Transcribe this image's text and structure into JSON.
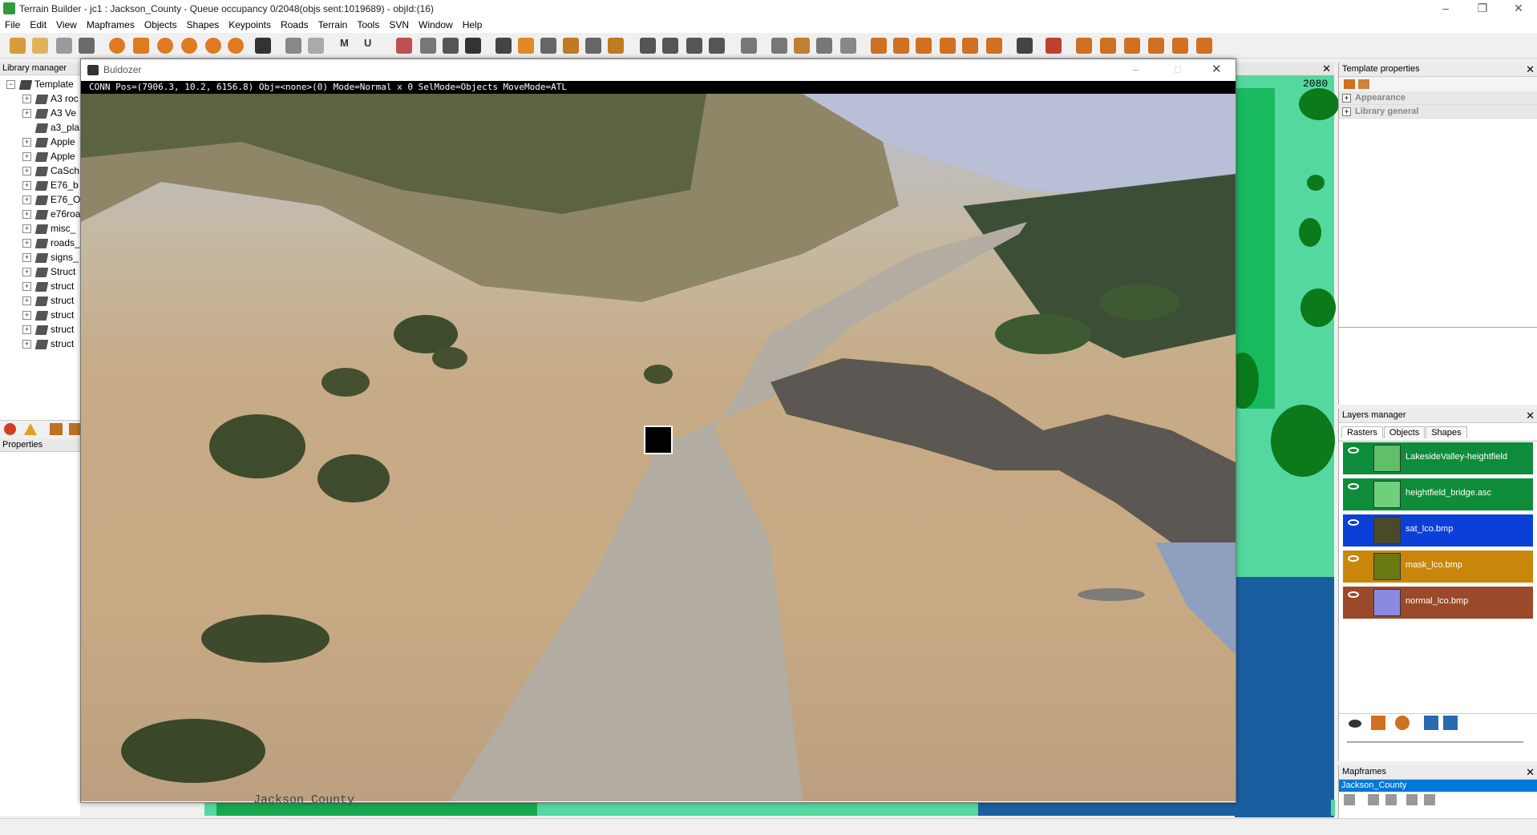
{
  "app": {
    "title": "Terrain Builder - jc1 : Jackson_County - Queue occupancy 0/2048(objs sent:1019689) - objId:(16)"
  },
  "menu": [
    "File",
    "Edit",
    "View",
    "Mapframes",
    "Objects",
    "Shapes",
    "Keypoints",
    "Roads",
    "Terrain",
    "Tools",
    "SVN",
    "Window",
    "Help"
  ],
  "library_manager": {
    "title": "Library manager",
    "root": "Template",
    "items": [
      "A3 roc",
      "A3 Ve",
      "a3_pla",
      "Apple",
      "Apple",
      "CaSch",
      "E76_b",
      "E76_O",
      "e76roa",
      "misc_",
      "roads_",
      "signs_",
      "Struct",
      "struct",
      "struct",
      "struct",
      "struct",
      "struct"
    ]
  },
  "properties": {
    "title": "Properties"
  },
  "map": {
    "coord_readout": "2080"
  },
  "buldozer": {
    "title": "Buldozer",
    "status": "CONN Pos=(7906.3, 10.2, 6156.8) Obj=<none>(0) Mode=Normal x 0 SelMode=Objects MoveMode=ATL"
  },
  "template_properties": {
    "title": "Template properties",
    "groups": [
      "Appearance",
      "Library general"
    ]
  },
  "layers_manager": {
    "title": "Layers manager",
    "tabs": [
      "Rasters",
      "Objects",
      "Shapes"
    ],
    "layers": [
      {
        "name": "LakesideValley-heightfield",
        "color": "#0e8c3a",
        "thumb": "#5fbf6a"
      },
      {
        "name": "heightfield_bridge.asc",
        "color": "#0e8c3a",
        "thumb": "#6fcf7a"
      },
      {
        "name": "sat_lco.bmp",
        "color": "#0b3fd8",
        "thumb": "#4a4a2a"
      },
      {
        "name": "mask_lco.bmp",
        "color": "#c8860c",
        "thumb": "#6a7a10"
      },
      {
        "name": "normal_lco.bmp",
        "color": "#9a4a2a",
        "thumb": "#8a8ae0"
      }
    ]
  },
  "mapframes": {
    "title": "Mapframes",
    "selected": "Jackson_County"
  },
  "map_label": "Jackson_County",
  "colors": {
    "accent": "#0078d7"
  }
}
